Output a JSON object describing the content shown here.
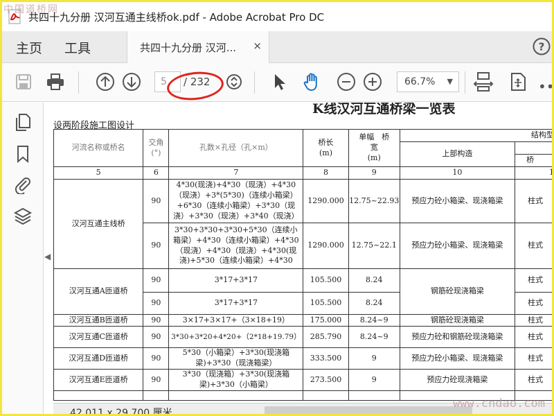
{
  "window": {
    "title": "共四十九分册 汉河互通主线桥ok.pdf - Adobe Acrobat Pro DC",
    "watermark_top": "中国道桥网",
    "watermark_bottom": "www.cndao.com"
  },
  "menu": {
    "home": "主页",
    "tools": "工具",
    "doc_tab": "共四十九分册 汉河...",
    "close": "×",
    "help": "?"
  },
  "toolbar": {
    "current_page": "5",
    "total_pages": "/ 232",
    "zoom": "66.7%",
    "zoom_caret": "▼"
  },
  "icons": {
    "save": "save-icon",
    "print": "print-icon",
    "prev": "page-up-icon",
    "next": "page-down-icon",
    "cursor": "select-cursor-icon",
    "hand": "hand-icon",
    "zoom_out": "zoom-out-icon",
    "zoom_in": "zoom-in-icon"
  },
  "document": {
    "title": "K线汉河互通桥梁一览表",
    "subtitle": "设两阶段施工图设计",
    "headers": {
      "name": "河流名称或桥名",
      "angle": "交角\n(°)",
      "spans": "孔数×孔径（孔×m）",
      "length": "桥长\n(m)",
      "width": "单幅　桥\n宽\n(m)",
      "structure": "结构型",
      "superstructure": "上部构造",
      "sub_cut": "桥"
    },
    "col_numbers": [
      "5",
      "6",
      "7",
      "8",
      "9",
      "10",
      "1"
    ],
    "rows": [
      {
        "name": "汉河互通主线桥",
        "angle": "90",
        "spans": "4*30(现浇)+4*30（现浇）+4*30（现浇）+3*(5*30)（连续小箱梁）+6*30（连续小箱梁）+3*30（现浇）+3*30（现浇）+3*40（现浇）",
        "length": "1290.000",
        "width": "12.75~22.93",
        "super": "预应力砼小箱梁、现浇箱梁",
        "sub": "柱式"
      },
      {
        "name": "",
        "angle": "90",
        "spans": "3*30+3*30+3*30+5*30（连续小箱梁）+4*30（连续小箱梁）+4*30（现浇）+4*30（现浇）+4*30(现浇)+5*30（连续小箱梁）+4*30",
        "length": "1290.000",
        "width": "12.75~22.1",
        "super": "预应力砼小箱梁、现浇箱梁",
        "sub": "柱式"
      },
      {
        "name": "汉河互通A匝道桥",
        "angle": "90",
        "spans": "3*17+3*17",
        "length": "105.500",
        "width": "8.24",
        "super": "钢筋砼现浇箱梁",
        "sub": "柱式"
      },
      {
        "name": "",
        "angle": "90",
        "spans": "3*17+3*17",
        "length": "105.500",
        "width": "8.24",
        "super": "",
        "sub": "柱式"
      },
      {
        "name": "汉河互通B匝道桥",
        "angle": "90",
        "spans": "3×17+3×17+（3×18+19）",
        "length": "175.000",
        "width": "8.24~9",
        "super": "钢筋砼现浇箱梁",
        "sub": "柱式"
      },
      {
        "name": "汉河互通C匝道桥",
        "angle": "90",
        "spans": "3*30+3*20+4*20+（2*18+19.79）",
        "length": "285.790",
        "width": "8.24~9",
        "super": "预应力砼和钢筋砼现浇箱梁",
        "sub": "柱式"
      },
      {
        "name": "汉河互通D匝道桥",
        "angle": "90",
        "spans": "5*30（小箱梁）+3*30(现浇箱梁)+3*30（现浇箱梁）",
        "length": "333.500",
        "width": "9",
        "super": "预应力砼小箱梁、现浇箱梁",
        "sub": "柱式"
      },
      {
        "name": "汉河互通E匝道桥",
        "angle": "90",
        "spans": "3*30（现浇箱）+3*30(现浇箱梁)+3*30（小箱梁）",
        "length": "273.500",
        "width": "9",
        "super": "预应力砼现浇箱梁",
        "sub": "柱式"
      }
    ]
  },
  "status": {
    "page_size": "42.011 x 29.700 厘米"
  }
}
